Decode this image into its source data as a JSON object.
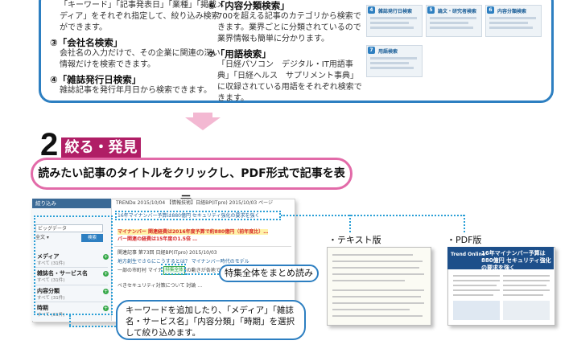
{
  "top": {
    "item1_text": "「キーワード」「記事発表日」「業種」「掲載メディア」をそれぞれ指定して、絞り込み検索ができます。",
    "item3_heading": "③「会社名検索」",
    "item3_desc": "会社名の入力だけで、その企業に関連の深い情報だけを検索できます。",
    "item4_heading": "④「雑誌発行日検索」",
    "item4_desc": "雑誌記事を発行年月日から検索できます。",
    "item6_heading": "⑥「内容分類検索」",
    "item6_desc": "700を超える記事のカテゴリから検索できます。業界ごとに分類されているので業界情報も簡単に分かります。",
    "item7_heading": "⑦「用語検索」",
    "item7_desc": "「日経パソコン　デジタル・IT用語事典」「日経ヘルス　サプリメント事典」に収録されている用語をそれぞれ検索できます。",
    "thumbs": [
      {
        "num": "4",
        "title": "雑誌発行日検索"
      },
      {
        "num": "5",
        "title": "論文・研究者検索"
      },
      {
        "num": "6",
        "title": "内容分類検索"
      },
      {
        "num": "7",
        "title": "用語検索"
      }
    ]
  },
  "step": {
    "number": "2",
    "title": "絞る・発見",
    "instruction": "読みたい記事のタイトルをクリックし、PDF形式で記事を表示。"
  },
  "screenshot": {
    "sidebar_header": "絞り込み",
    "keyword_box": "ビッグデータ",
    "scope_label": "全文",
    "search_button": "検索",
    "facets": [
      {
        "label": "メディア",
        "sub": "すべて (31件)"
      },
      {
        "label": "雑誌名・サービス名",
        "sub": "すべて (31件)"
      },
      {
        "label": "内容分類",
        "sub": "すべて (31件)"
      },
      {
        "label": "時期",
        "sub": "すべて (31件)"
      }
    ],
    "article1_meta": "TRENDα 2015/10/04 【情報技術】日経BP(ITpro) 2015/10/03 ページ",
    "article1_title": "16年マイナンバー予算は880億円 セキュリティ強化の要求を強く",
    "article1_body1": "マイナンバー 関連経費は2016年度予算で約880億円（前年度比）…",
    "article1_body2": "バー関連の経費は15年度の1.5倍 …",
    "article2_meta": "関連記事 第73回 日経BP(ITpro) 2015/10/03",
    "article2_title": "地方創生でさらにこうするとは？ マイナンバー時代のモデル",
    "article2_body": "一部の市町村 マイナンバー利用の動きが各地で拡がり…",
    "article2_tail": "ベきセキュリティ対策について 討論 …",
    "special_tag": "特集全体"
  },
  "callouts": {
    "tokushu": "特集全体をまとめ読み",
    "keyword": "キーワードを追加したり、「メディア」「雑誌名・サービス名」「内容分類」「時期」を選択して絞り込めます。"
  },
  "docs": {
    "text_label": "・テキスト版",
    "pdf_label": "・PDF版",
    "pdf_logo": "Trend Online",
    "pdf_title": "16年マイナンバー予算は880億円 セキュリティ強化の要求を強く"
  },
  "colors": {
    "blue": "#2d7fc1",
    "magenta": "#b01e66",
    "pink": "#e26aa8",
    "dotted": "#2a9fd6"
  }
}
